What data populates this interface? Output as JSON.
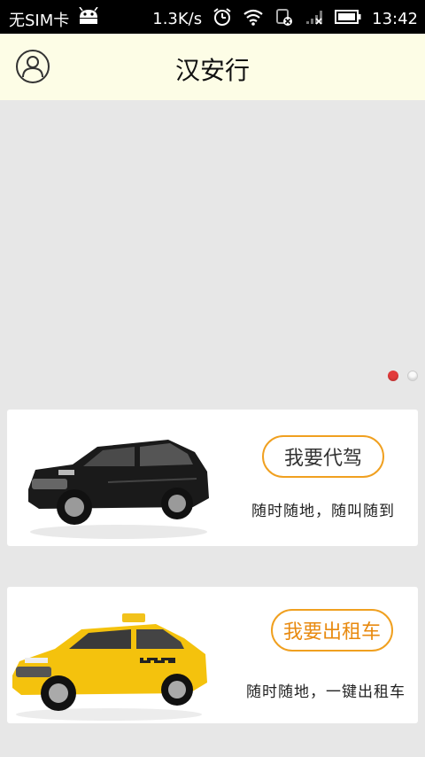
{
  "status_bar": {
    "carrier": "无SIM卡",
    "speed": "1.3K/s",
    "time": "13:42"
  },
  "header": {
    "title": "汉安行"
  },
  "banner": {
    "slides_total": 2,
    "active_index": 0
  },
  "cards": [
    {
      "button_label": "我要代驾",
      "tagline": "随时随地，随叫随到"
    },
    {
      "button_label": "我要出租车",
      "tagline": "随时随地，一键出租车"
    }
  ],
  "colors": {
    "accent": "#f0a020",
    "header_bg": "#fdfde6",
    "page_bg": "#e7e7e7",
    "dot_active": "#e23b3b"
  }
}
